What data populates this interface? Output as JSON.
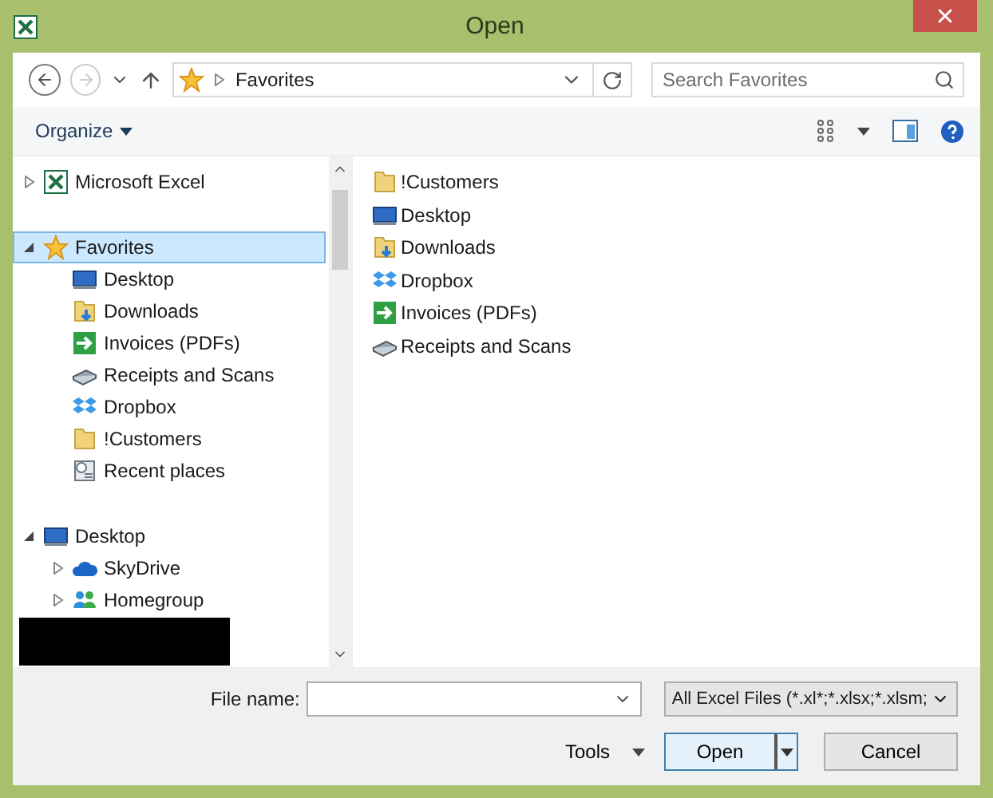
{
  "window": {
    "title": "Open"
  },
  "nav": {
    "path": "Favorites",
    "search_placeholder": "Search Favorites"
  },
  "toolbar": {
    "organize": "Organize"
  },
  "tree": [
    {
      "label": "Microsoft Excel",
      "kind": "excel",
      "expanded": false,
      "selected": false
    },
    {
      "label": "Favorites",
      "kind": "star",
      "expanded": true,
      "selected": true,
      "children": [
        {
          "label": "Desktop",
          "kind": "desktop",
          "selected": false
        },
        {
          "label": "Downloads",
          "kind": "downloads",
          "selected": false
        },
        {
          "label": "Invoices (PDFs)",
          "kind": "arrow",
          "selected": false
        },
        {
          "label": "Receipts and Scans",
          "kind": "scanner",
          "selected": false
        },
        {
          "label": "Dropbox",
          "kind": "dropbox",
          "selected": false
        },
        {
          "label": "!Customers",
          "kind": "folder",
          "selected": false
        },
        {
          "label": "Recent places",
          "kind": "recent",
          "selected": false
        }
      ]
    },
    {
      "label": "Desktop",
      "kind": "desktop",
      "expanded": true,
      "selected": false,
      "children": [
        {
          "label": "SkyDrive",
          "kind": "cloud",
          "expanded": false,
          "selected": false
        },
        {
          "label": "Homegroup",
          "kind": "homegroup",
          "expanded": false,
          "selected": false
        }
      ]
    }
  ],
  "files": [
    {
      "label": "!Customers",
      "kind": "folder"
    },
    {
      "label": "Desktop",
      "kind": "desktop"
    },
    {
      "label": "Downloads",
      "kind": "downloads"
    },
    {
      "label": "Dropbox",
      "kind": "dropbox"
    },
    {
      "label": "Invoices (PDFs)",
      "kind": "arrow"
    },
    {
      "label": "Receipts and Scans",
      "kind": "scanner"
    }
  ],
  "footer": {
    "file_name_label": "File name:",
    "file_type": "All Excel Files (*.xl*;*.xlsx;*.xlsm;",
    "tools": "Tools",
    "open": "Open",
    "cancel": "Cancel"
  }
}
